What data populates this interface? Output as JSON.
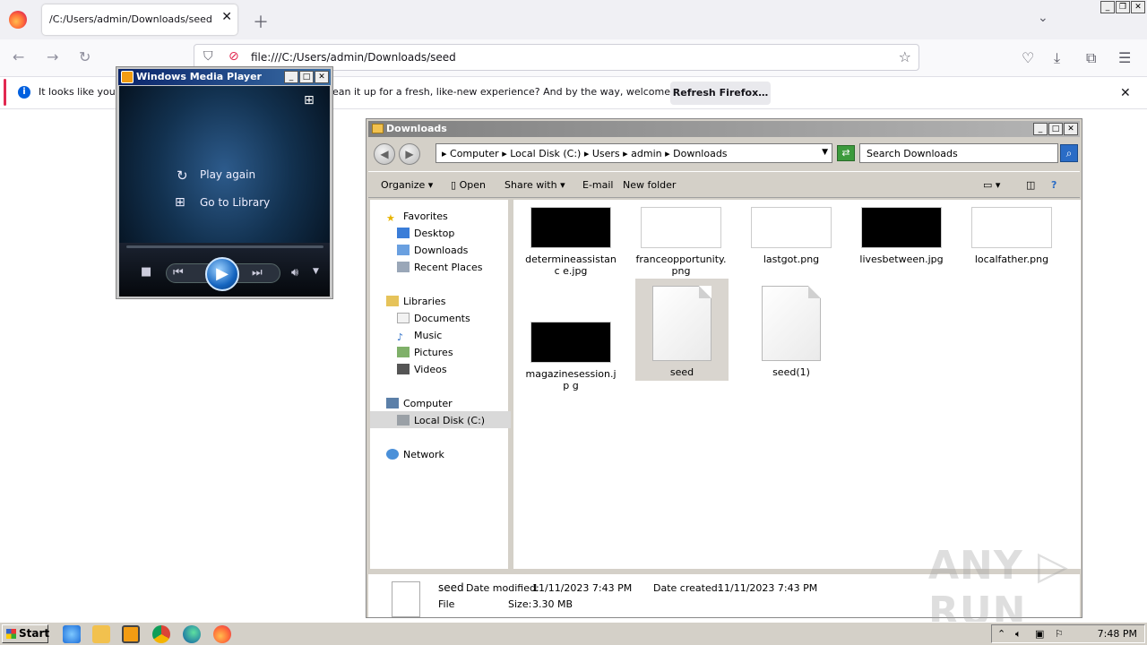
{
  "browser": {
    "tab_title": "/C:/Users/admin/Downloads/seed",
    "url": "file:///C:/Users/admin/Downloads/seed",
    "notification_text_left": "It looks like you h",
    "notification_text_right": "ean it up for a fresh, like-new experience? And by the way, welcome back!",
    "refresh_button": "Refresh Firefox…"
  },
  "wmp": {
    "title": "Windows Media Player",
    "play_again": "Play again",
    "go_to_library": "Go to Library"
  },
  "explorer": {
    "title": "Downloads",
    "breadcrumbs": "▸ Computer ▸ Local Disk (C:) ▸ Users ▸ admin ▸ Downloads",
    "search_placeholder": "Search Downloads",
    "toolbar": {
      "organize": "Organize",
      "open": "Open",
      "share_with": "Share with",
      "email": "E-mail",
      "new_folder": "New folder"
    },
    "nav": {
      "favorites": "Favorites",
      "desktop": "Desktop",
      "downloads": "Downloads",
      "recent_places": "Recent Places",
      "libraries": "Libraries",
      "documents": "Documents",
      "music": "Music",
      "pictures": "Pictures",
      "videos": "Videos",
      "computer": "Computer",
      "local_disk": "Local Disk (C:)",
      "network": "Network"
    },
    "files": [
      {
        "name": "determineassistanc e.jpg"
      },
      {
        "name": "franceopportunity. png"
      },
      {
        "name": "lastgot.png"
      },
      {
        "name": "livesbetween.jpg"
      },
      {
        "name": "localfather.png"
      },
      {
        "name": "magazinesession.jp g"
      },
      {
        "name": "seed"
      },
      {
        "name": "seed(1)"
      }
    ],
    "details": {
      "name": "seed",
      "date_modified_label": "Date modified:",
      "date_modified": "11/11/2023 7:43 PM",
      "date_created_label": "Date created:",
      "date_created": "11/11/2023 7:43 PM",
      "type": "File",
      "size_label": "Size:",
      "size": "3.30 MB"
    }
  },
  "watermark": "ANY ▷ RUN",
  "taskbar": {
    "start": "Start",
    "time": "7:48 PM"
  }
}
